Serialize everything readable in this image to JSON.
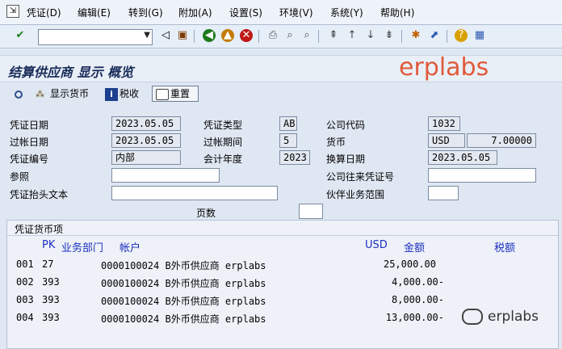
{
  "menu": {
    "items": [
      "凭证(D)",
      "编辑(E)",
      "转到(G)",
      "附加(A)",
      "设置(S)",
      "环境(V)",
      "系统(Y)",
      "帮助(H)"
    ]
  },
  "toolbar": {
    "command_value": ""
  },
  "title": "结算供应商 显示 概览",
  "watermark": "erplabs",
  "app_toolbar": {
    "display_currency": "显示货币",
    "tax": "税收",
    "reset": "重置"
  },
  "header": {
    "doc_date_label": "凭证日期",
    "doc_date": "2023.05.05",
    "doc_type_label": "凭证类型",
    "doc_type": "AB",
    "company_code_label": "公司代码",
    "company_code": "1032",
    "posting_date_label": "过帐日期",
    "posting_date": "2023.05.05",
    "period_label": "过帐期间",
    "period": "5",
    "currency_label": "货币",
    "currency": "USD",
    "exchange_rate": "7.00000",
    "doc_number_label": "凭证编号",
    "doc_number": "内部",
    "fiscal_year_label": "会计年度",
    "fiscal_year": "2023",
    "translation_date_label": "换算日期",
    "translation_date": "2023.05.05",
    "reference_label": "参照",
    "reference": "",
    "intercompany_label": "公司往来凭证号",
    "intercompany": "",
    "header_text_label": "凭证抬头文本",
    "header_text": "",
    "partner_ba_label": "伙伴业务范围",
    "partner_ba": "",
    "page_label": "页数",
    "page": ""
  },
  "items": {
    "group_title": "凭证货币项",
    "columns": {
      "pk": "PK",
      "dept": "业务部门",
      "account": "帐户",
      "currency": "USD",
      "amount": "金额",
      "tax": "税额"
    },
    "rows": [
      {
        "no": "001",
        "pk": "27",
        "account": "0000100024 B外币供应商 erplabs",
        "amount": "25,000.00"
      },
      {
        "no": "002",
        "pk": "393",
        "account": "0000100024 B外币供应商 erplabs",
        "amount": "4,000.00-"
      },
      {
        "no": "003",
        "pk": "393",
        "account": "0000100024 B外币供应商 erplabs",
        "amount": "8,000.00-"
      },
      {
        "no": "004",
        "pk": "393",
        "account": "0000100024 B外币供应商 erplabs",
        "amount": "13,000.00-"
      }
    ]
  },
  "wechat_watermark": "erplabs"
}
